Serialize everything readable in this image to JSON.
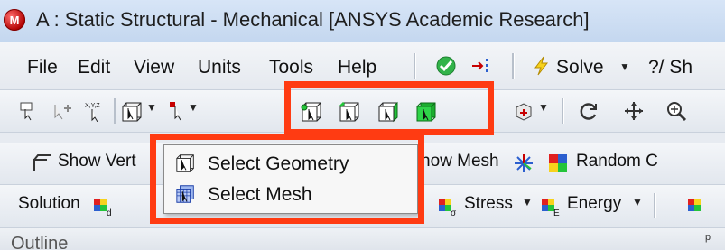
{
  "window": {
    "title": "A : Static Structural - Mechanical [ANSYS Academic Research]",
    "app_icon_letter": "M"
  },
  "menu": {
    "items": [
      "File",
      "Edit",
      "View",
      "Units",
      "Tools",
      "Help"
    ],
    "solve_label": "Solve",
    "probe_label": "?/ Sh"
  },
  "toolbar2": {
    "icons": [
      "select-mode-icon",
      "add-point-icon",
      "xyz-coordinate-icon",
      "select-geometry-dropdown-icon",
      "select-type-icon",
      "select-vertex-icon",
      "select-edge-icon",
      "select-face-icon",
      "select-body-icon",
      "add-component-icon",
      "rotate-icon",
      "pan-icon",
      "zoom-icon"
    ]
  },
  "toolbar3": {
    "show_vertices_label": "Show Vert",
    "show_mesh_label": "how Mesh",
    "random_colors_label": "Random C"
  },
  "toolbar4": {
    "solution_label": "Solution",
    "deformation_sub": "d",
    "stress_label": "Stress",
    "stress_sub": "σ",
    "energy_label": "Energy",
    "energy_sub": "E"
  },
  "popup": {
    "items": [
      {
        "label": "Select Geometry",
        "icon": "select-geometry-icon"
      },
      {
        "label": "Select Mesh",
        "icon": "select-mesh-icon"
      }
    ]
  },
  "outline": {
    "label": "Outline",
    "pin": "ᵖ"
  },
  "colors": {
    "highlight": "#ff3b12",
    "green_face": "#24c43a",
    "red_icon": "#c70000"
  }
}
